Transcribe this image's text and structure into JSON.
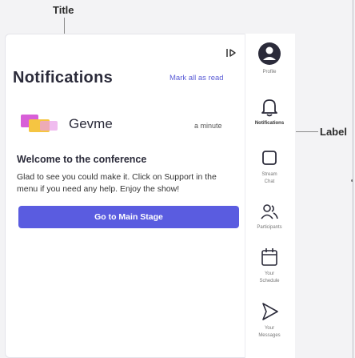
{
  "annotations": {
    "title_label": "Title",
    "label_label": "Label"
  },
  "notifications": {
    "header_title": "Notifications",
    "mark_all_read": "Mark all as read",
    "entry": {
      "sender": "Gevme",
      "time": "a minute",
      "title": "Welcome to the conference",
      "body": "Glad to see you could make it. Click on Support in the menu if you need any help. Enjoy the show!",
      "cta": "Go to Main Stage"
    }
  },
  "rail": {
    "items": [
      {
        "label": "Profile",
        "icon": "profile-icon"
      },
      {
        "label": "Notifications",
        "icon": "bell-icon"
      },
      {
        "label": "Stream Chat",
        "icon": "chat-icon"
      },
      {
        "label": "Participants",
        "icon": "participants-icon"
      },
      {
        "label": "Your Schedule",
        "icon": "calendar-icon"
      },
      {
        "label": "Your Messages",
        "icon": "send-icon"
      }
    ]
  },
  "colors": {
    "accent": "#5a5ce0",
    "icon_dark": "#2b2b3a",
    "logo_pink": "#d85fd8",
    "logo_yellow": "#f5c542"
  }
}
